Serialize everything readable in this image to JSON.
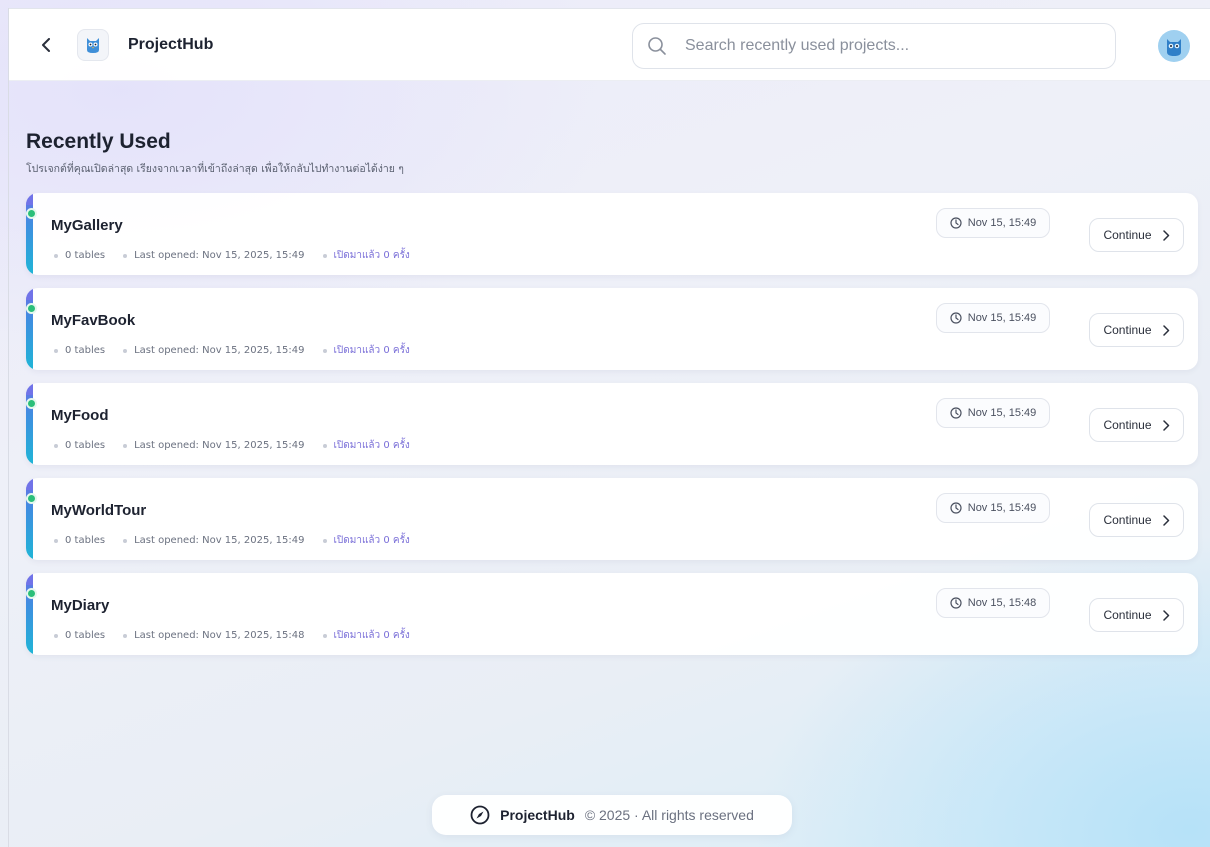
{
  "header": {
    "app_name": "ProjectHub",
    "search_placeholder": "Search recently used projects..."
  },
  "section": {
    "title": "Recently Used",
    "subtitle": "โปรเจกต์ที่คุณเปิดล่าสุด เรียงจากเวลาที่เข้าถึงล่าสุด เพื่อให้กลับไปทำงานต่อได้ง่าย ๆ"
  },
  "projects": [
    {
      "name": "MyGallery",
      "tables": "0 tables",
      "last_opened": "Last opened: Nov 15, 2025, 15:49",
      "visits": "เปิดมาแล้ว 0 ครั้ง",
      "time": "Nov 15, 15:49",
      "action": "Continue"
    },
    {
      "name": "MyFavBook",
      "tables": "0 tables",
      "last_opened": "Last opened: Nov 15, 2025, 15:49",
      "visits": "เปิดมาแล้ว 0 ครั้ง",
      "time": "Nov 15, 15:49",
      "action": "Continue"
    },
    {
      "name": "MyFood",
      "tables": "0 tables",
      "last_opened": "Last opened: Nov 15, 2025, 15:49",
      "visits": "เปิดมาแล้ว 0 ครั้ง",
      "time": "Nov 15, 15:49",
      "action": "Continue"
    },
    {
      "name": "MyWorldTour",
      "tables": "0 tables",
      "last_opened": "Last opened: Nov 15, 2025, 15:49",
      "visits": "เปิดมาแล้ว 0 ครั้ง",
      "time": "Nov 15, 15:49",
      "action": "Continue"
    },
    {
      "name": "MyDiary",
      "tables": "0 tables",
      "last_opened": "Last opened: Nov 15, 2025, 15:48",
      "visits": "เปิดมาแล้ว 0 ครั้ง",
      "time": "Nov 15, 15:48",
      "action": "Continue"
    }
  ],
  "footer": {
    "brand": "ProjectHub",
    "copyright": "© 2025 · All rights reserved"
  },
  "icons": {
    "back": "chevron-left-icon",
    "logo": "owl-logo-icon",
    "search": "search-icon",
    "avatar": "owl-avatar-icon",
    "clock": "clock-icon",
    "chevron": "chevron-right-icon",
    "footer_logo": "compass-icon"
  },
  "colors": {
    "accent_start": "#6b6ee6",
    "accent_end": "#1fb5d6",
    "status_dot": "#2bbf7a",
    "visits_text": "#7a6fd8"
  }
}
